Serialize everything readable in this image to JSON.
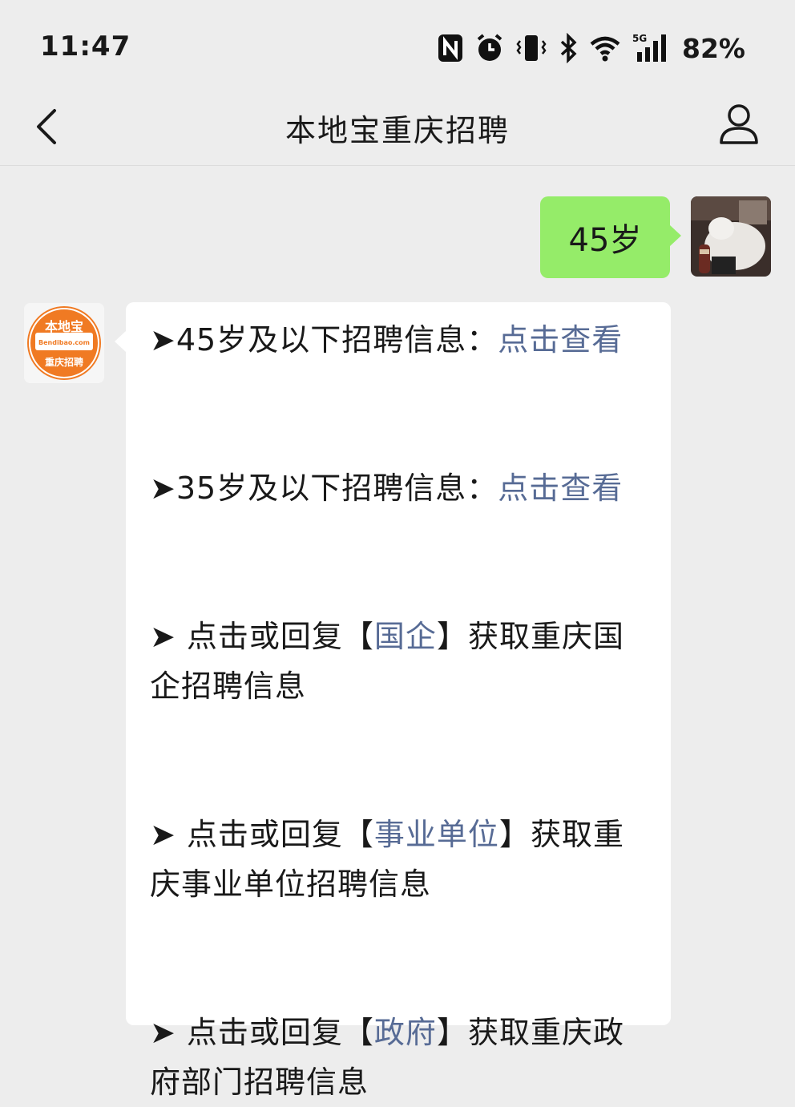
{
  "status_bar": {
    "time": "11:47",
    "network": "5G",
    "battery": "82%",
    "icons": [
      "nfc-icon",
      "alarm-icon",
      "vibrate-icon",
      "bluetooth-icon",
      "wifi-icon",
      "signal-icon"
    ]
  },
  "header": {
    "title": "本地宝重庆招聘",
    "back_icon": "chevron-left-icon",
    "profile_icon": "person-icon"
  },
  "chat": {
    "user_message": "45岁",
    "bot_avatar": {
      "top_text": "本地宝",
      "site_text": "Bendibao.com",
      "bottom_text": "重庆招聘",
      "color": "#f07a23"
    },
    "bot_lines": [
      {
        "prefix": "➤45岁及以下招聘信息：",
        "link": "点击查看",
        "suffix": ""
      },
      {
        "prefix": "➤35岁及以下招聘信息：",
        "link": "点击查看",
        "suffix": ""
      },
      {
        "prefix": "➤ 点击或回复【",
        "link": "国企",
        "suffix": "】获取重庆国企招聘信息"
      },
      {
        "prefix": "➤ 点击或回复【",
        "link": "事业单位",
        "suffix": "】获取重庆事业单位招聘信息"
      },
      {
        "prefix": "➤ 点击或回复【",
        "link": "政府",
        "suffix": "】获取重庆政府部门招聘信息"
      }
    ]
  },
  "colors": {
    "background": "#ededed",
    "user_bubble": "#95ec69",
    "bot_bubble": "#ffffff",
    "link": "#576b95"
  }
}
